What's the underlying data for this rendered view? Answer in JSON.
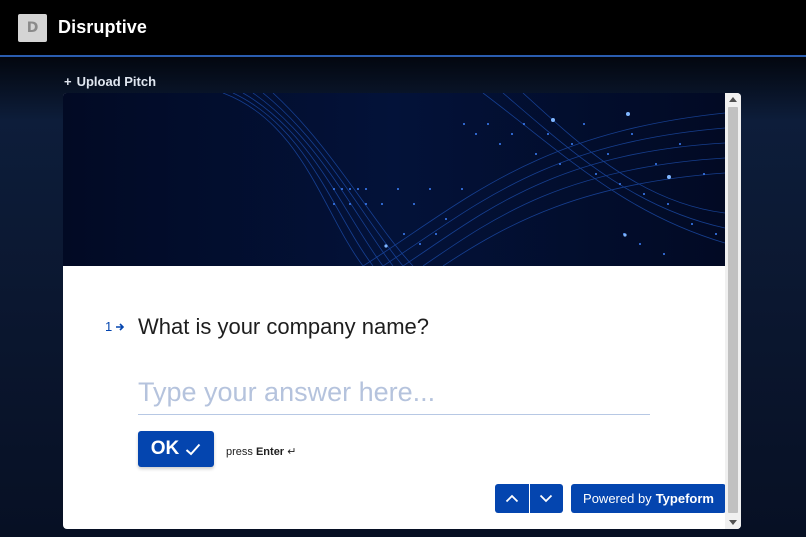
{
  "app": {
    "logo_letter": "D",
    "title": "Disruptive"
  },
  "upload": {
    "label": "Upload Pitch",
    "icon": "plus-icon"
  },
  "form": {
    "question_number": "1",
    "question_text": "What is your company name?",
    "answer_placeholder": "Type your answer here...",
    "answer_value": "",
    "ok_label": "OK",
    "press_label": "press",
    "key_label": "Enter",
    "key_symbol": "↵",
    "nav_up_icon": "chevron-up-icon",
    "nav_down_icon": "chevron-down-icon",
    "powered_prefix": "Powered by",
    "powered_brand": "Typeform"
  },
  "colors": {
    "accent": "#0445af",
    "topbar": "#000000",
    "page_bg": "#0b1730"
  }
}
